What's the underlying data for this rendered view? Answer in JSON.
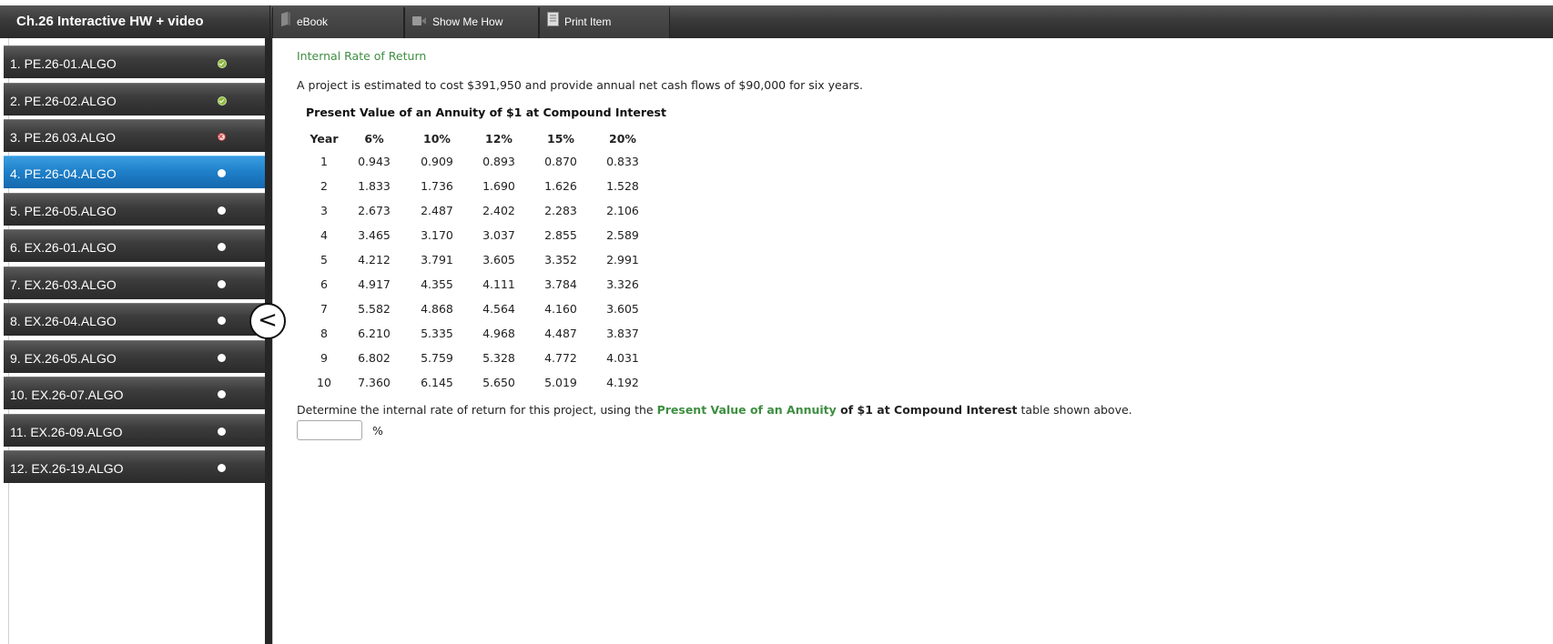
{
  "header": {
    "assignment_title": "Ch.26 Interactive HW + video",
    "tools": [
      {
        "label": "eBook",
        "icon": "ebook-icon"
      },
      {
        "label": "Show Me How",
        "icon": "video-icon"
      },
      {
        "label": "Print Item",
        "icon": "print-icon"
      }
    ]
  },
  "sidebar": {
    "items": [
      {
        "label": "1. PE.26-01.ALGO",
        "status": "correct"
      },
      {
        "label": "2. PE.26-02.ALGO",
        "status": "correct"
      },
      {
        "label": "3. PE.26.03.ALGO",
        "status": "incorrect"
      },
      {
        "label": "4. PE.26-04.ALGO",
        "status": "pending",
        "active": true
      },
      {
        "label": "5. PE.26-05.ALGO",
        "status": "pending"
      },
      {
        "label": "6. EX.26-01.ALGO",
        "status": "pending"
      },
      {
        "label": "7. EX.26-03.ALGO",
        "status": "pending"
      },
      {
        "label": "8. EX.26-04.ALGO",
        "status": "pending"
      },
      {
        "label": "9. EX.26-05.ALGO",
        "status": "pending"
      },
      {
        "label": "10. EX.26-07.ALGO",
        "status": "pending"
      },
      {
        "label": "11. EX.26-09.ALGO",
        "status": "pending"
      },
      {
        "label": "12. EX.26-19.ALGO",
        "status": "pending"
      }
    ],
    "collapse_glyph": "<"
  },
  "question": {
    "title": "Internal Rate of Return",
    "text": "A project is estimated to cost $391,950 and provide annual net cash flows of $90,000 for six years.",
    "table_caption": "Present Value of an Annuity of $1 at Compound Interest",
    "table_headers": [
      "Year",
      "6%",
      "10%",
      "12%",
      "15%",
      "20%"
    ],
    "table_rows": [
      [
        "1",
        "0.943",
        "0.909",
        "0.893",
        "0.870",
        "0.833"
      ],
      [
        "2",
        "1.833",
        "1.736",
        "1.690",
        "1.626",
        "1.528"
      ],
      [
        "3",
        "2.673",
        "2.487",
        "2.402",
        "2.283",
        "2.106"
      ],
      [
        "4",
        "3.465",
        "3.170",
        "3.037",
        "2.855",
        "2.589"
      ],
      [
        "5",
        "4.212",
        "3.791",
        "3.605",
        "3.352",
        "2.991"
      ],
      [
        "6",
        "4.917",
        "4.355",
        "4.111",
        "3.784",
        "3.326"
      ],
      [
        "7",
        "5.582",
        "4.868",
        "4.564",
        "4.160",
        "3.605"
      ],
      [
        "8",
        "6.210",
        "5.335",
        "4.968",
        "4.487",
        "3.837"
      ],
      [
        "9",
        "6.802",
        "5.759",
        "5.328",
        "4.772",
        "4.031"
      ],
      [
        "10",
        "7.360",
        "6.145",
        "5.650",
        "5.019",
        "4.192"
      ]
    ],
    "prompt_before": "Determine the internal rate of return for this project, using the ",
    "prompt_highlight": "Present Value of an Annuity",
    "prompt_bold": " of $1 at Compound Interest",
    "prompt_after": " table shown above.",
    "answer_value": "",
    "answer_unit": "%"
  },
  "colors": {
    "accent_green": "#3e8e41",
    "active_blue": "#1e7fc8",
    "nav_dark": "#2a2a2a"
  }
}
